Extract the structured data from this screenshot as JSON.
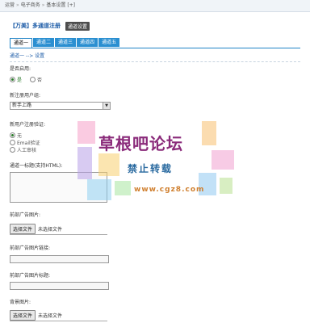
{
  "breadcrumb": {
    "items": [
      "运营",
      "电子商务",
      "基本设置"
    ],
    "extra": "[+]"
  },
  "header": {
    "title": "【万美】多通道注册",
    "settings_label": "通道设置"
  },
  "tabs": [
    "通道一",
    "通道二",
    "通道三",
    "通道四",
    "通道五"
  ],
  "active_tab": 0,
  "section_path": "通道一 --> 设置",
  "fields": {
    "enable": {
      "label": "是否启用:",
      "options": [
        "是",
        "否"
      ],
      "selected": 0
    },
    "group": {
      "label": "新注册用户组:",
      "value": "新手上路"
    },
    "verify": {
      "label": "新用户注册验证:",
      "options": [
        "无",
        "Email验证",
        "人工审核"
      ],
      "selected": 0
    },
    "header_html": {
      "label": "通道一标题(支持HTML):"
    },
    "banner_image": {
      "label": "前部广告图片:",
      "button": "选择文件",
      "status": "未选择文件"
    },
    "banner_link": {
      "label": "前部广告图片链接:"
    },
    "banner_title": {
      "label": "前部广告图片标题:"
    },
    "bg_image": {
      "label": "背景图片:",
      "button": "选择文件",
      "status": "未选择文件"
    }
  },
  "watermark": {
    "line1": "草根吧论坛",
    "line2": "禁止转载",
    "line3": "www.cgz8.com"
  },
  "colors": {
    "tab_bg": "#2a8fd1",
    "link": "#1a5aa6",
    "settings_bg": "#4d4d4d"
  }
}
